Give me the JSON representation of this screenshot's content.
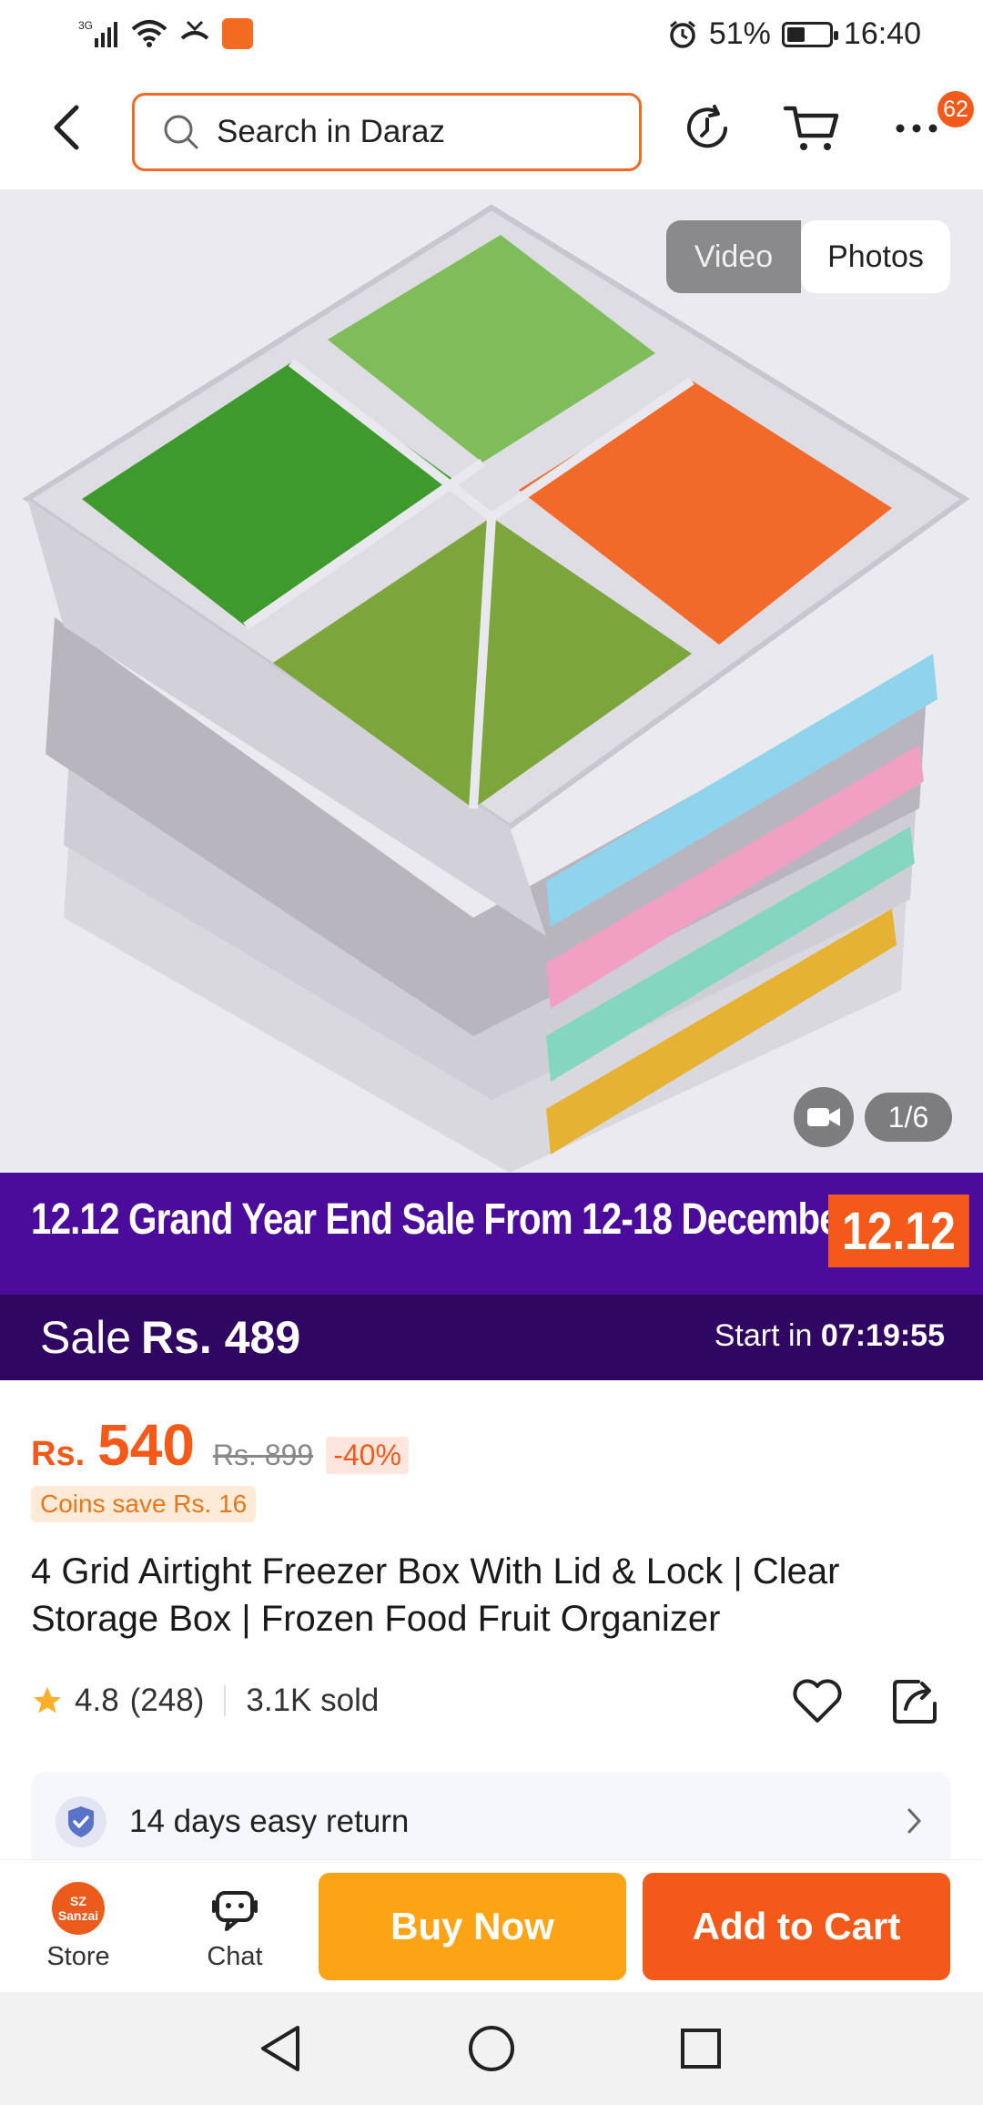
{
  "status_bar": {
    "network": "3G",
    "battery_percent": "51%",
    "battery_level": 0.51,
    "time": "16:40"
  },
  "header": {
    "search_placeholder": "Search in Daraz",
    "more_badge": "62",
    "icons": [
      "back-icon",
      "search-icon",
      "history-icon",
      "cart-icon",
      "more-icon"
    ]
  },
  "gallery": {
    "tab_video": "Video",
    "tab_photos": "Photos",
    "selected_tab": "Photos",
    "page_indicator": "1/6"
  },
  "promo": {
    "banner_text": "12.12 Grand Year End Sale From 12-18 December",
    "badge_text": "12.12",
    "sale_label": "Sale",
    "sale_price": "Rs. 489",
    "start_label": "Start in",
    "countdown": "07:19:55"
  },
  "pricing": {
    "currency": "Rs.",
    "price": "540",
    "original_price": "Rs. 899",
    "discount": "-40%",
    "coins_text": "Coins save Rs. 16"
  },
  "product": {
    "title": "4 Grid Airtight Freezer Box With Lid & Lock | Clear Storage Box | Frozen Food Fruit Organizer",
    "rating": "4.8",
    "review_count": "(248)",
    "sold": "3.1K sold"
  },
  "service": {
    "return_text": "14 days easy return"
  },
  "actions": {
    "store_label": "Store",
    "store_logo_text": "SZ Sanzai",
    "chat_label": "Chat",
    "buy_now": "Buy Now",
    "add_to_cart": "Add to Cart"
  },
  "colors": {
    "brand_orange": "#f35a19",
    "buy_now_yellow": "#fca416",
    "promo_purple": "#4b0c9c",
    "promo_dark": "#2f0661"
  }
}
